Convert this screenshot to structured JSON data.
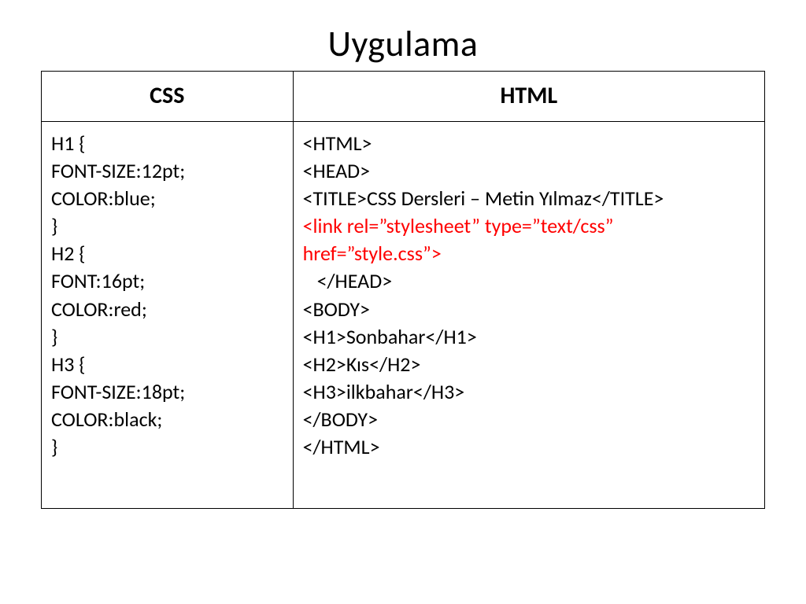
{
  "title": "Uygulama",
  "columns": {
    "css": "CSS",
    "html": "HTML"
  },
  "css_code": {
    "l1": "H1 {",
    "l2": "FONT-SIZE:12pt;",
    "l3": "COLOR:blue;",
    "l4": "}",
    "l5": "H2 {",
    "l6": "FONT:16pt;",
    "l7": "COLOR:red;",
    "l8": "}",
    "l9": "H3 {",
    "l10": "FONT-SIZE:18pt;",
    "l11": "COLOR:black;",
    "l12": "}"
  },
  "html_code": {
    "l1": "<HTML>",
    "l2": "<HEAD>",
    "l3": "<TITLE>CSS Dersleri – Metin Yılmaz</TITLE>",
    "l4": "<link rel=”stylesheet” type=”text/css” href=”style.css”>",
    "l5": "</HEAD>",
    "l6": "<BODY>",
    "l7": "<H1>Sonbahar</H1>",
    "l8": "<H2>Kıs</H2>",
    "l9": "<H3>ilkbahar</H3>",
    "l10": "</BODY>",
    "l11": "</HTML>"
  }
}
